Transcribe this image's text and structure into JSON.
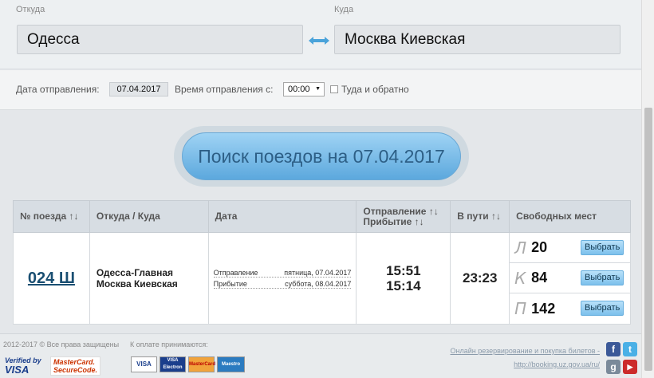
{
  "form": {
    "from_label": "Откуда",
    "to_label": "Куда",
    "from_value": "Одесса",
    "to_value": "Москва Киевская",
    "date_label": "Дата отправления:",
    "date_value": "07.04.2017",
    "time_label": "Время отправления с:",
    "time_value": "00:00",
    "roundtrip_label": "Туда и обратно"
  },
  "search": {
    "button_label": "Поиск поездов на 07.04.2017"
  },
  "table": {
    "headers": {
      "number": "№ поезда ↑↓",
      "route": "Откуда / Куда",
      "date": "Дата",
      "departure": "Отправление ↑↓",
      "arrival": "Прибытие ↑↓",
      "travel": "В пути ↑↓",
      "seats": "Свободных мест"
    },
    "rows": [
      {
        "number": "024 Ш",
        "from": "Одесса-Главная",
        "to": "Москва Киевская",
        "dep_label": "Отправление",
        "dep_date": "пятница, 07.04.2017",
        "arr_label": "Прибытие",
        "arr_date": "суббота, 08.04.2017",
        "dep_time": "15:51",
        "arr_time": "15:14",
        "travel_time": "23:23",
        "seats": [
          {
            "type": "Л",
            "count": "20",
            "button": "Выбрать"
          },
          {
            "type": "К",
            "count": "84",
            "button": "Выбрать"
          },
          {
            "type": "П",
            "count": "142",
            "button": "Выбрать"
          }
        ]
      }
    ]
  },
  "footer": {
    "copyright": "2012-2017 © Все права защищены",
    "payment_label": "К оплате принимаются:",
    "verified_line1": "Verified by",
    "verified_line2": "VISA",
    "securecode_line1": "MasterCard.",
    "securecode_line2": "SecureCode.",
    "cards": [
      "VISA",
      "VISA Electron",
      "MasterCard",
      "Maestro"
    ],
    "booking_text": "Онлайн резервирование и покупка билетов -",
    "booking_url": "http://booking.uz.gov.ua/ru/",
    "social": [
      "f",
      "t",
      "g",
      "▶"
    ]
  },
  "colors": {
    "accent": "#5ca8dd",
    "link": "#1a4f72"
  }
}
